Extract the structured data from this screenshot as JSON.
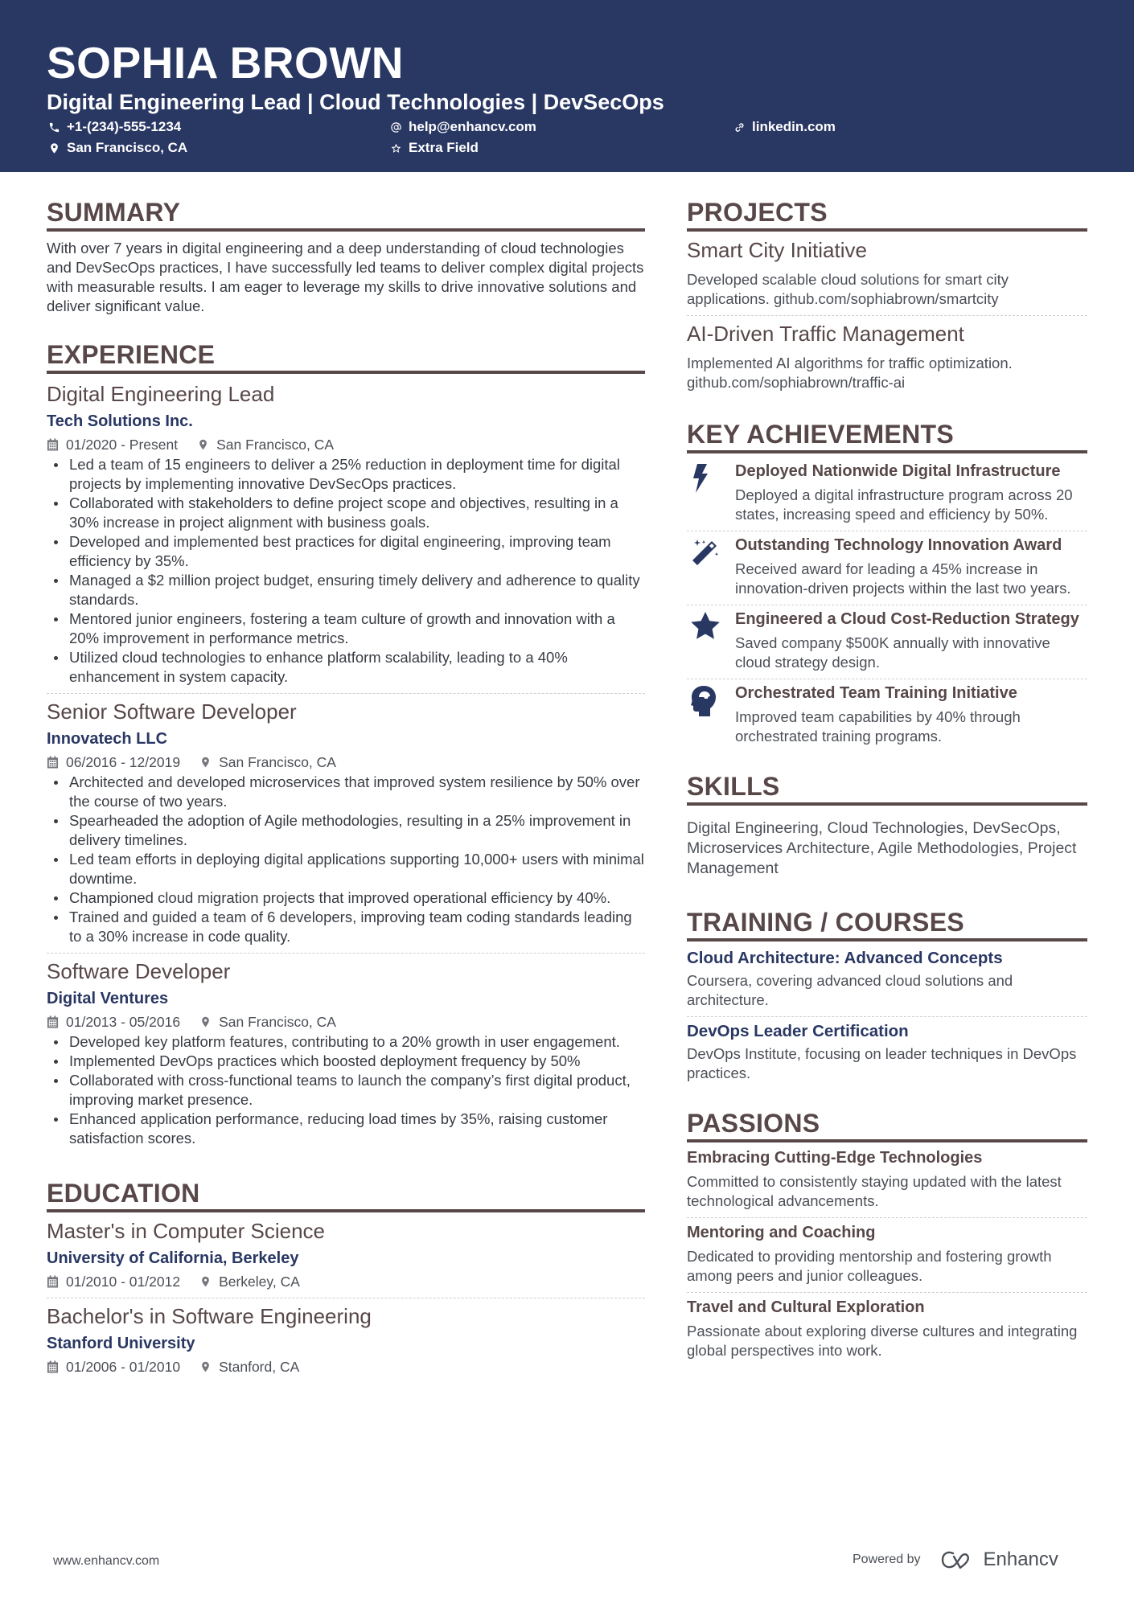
{
  "header": {
    "name": "SOPHIA BROWN",
    "headline": "Digital Engineering Lead | Cloud Technologies | DevSecOps",
    "contacts": [
      {
        "icon": "phone-icon",
        "text": "+1-(234)-555-1234"
      },
      {
        "icon": "at-icon",
        "text": "help@enhancv.com"
      },
      {
        "icon": "link-icon",
        "text": "linkedin.com"
      },
      {
        "icon": "map-pin-icon",
        "text": "San Francisco, CA"
      },
      {
        "icon": "star-outline-icon",
        "text": "Extra Field"
      }
    ]
  },
  "colors": {
    "header_bg": "#293763",
    "accent": "#293763",
    "heading": "#574748",
    "text": "#383c43"
  },
  "summary": {
    "title": "SUMMARY",
    "text": "With over 7 years in digital engineering and a deep understanding of cloud technologies and DevSecOps practices, I have successfully led teams to deliver complex digital projects with measurable results. I am eager to leverage my skills to drive innovative solutions and deliver significant value."
  },
  "experience": {
    "title": "EXPERIENCE",
    "items": [
      {
        "role": "Digital Engineering Lead",
        "company": "Tech Solutions Inc.",
        "dates": "01/2020 - Present",
        "location": "San Francisco, CA",
        "bullets": [
          "Led a team of 15 engineers to deliver a 25% reduction in deployment time for digital projects by implementing innovative DevSecOps practices.",
          "Collaborated with stakeholders to define project scope and objectives, resulting in a 30% increase in project alignment with business goals.",
          "Developed and implemented best practices for digital engineering, improving team efficiency by 35%.",
          "Managed a $2 million project budget, ensuring timely delivery and adherence to quality standards.",
          "Mentored junior engineers, fostering a team culture of growth and innovation with a 20% improvement in performance metrics.",
          "Utilized cloud technologies to enhance platform scalability, leading to a 40% enhancement in system capacity."
        ]
      },
      {
        "role": "Senior Software Developer",
        "company": "Innovatech LLC",
        "dates": "06/2016 - 12/2019",
        "location": "San Francisco, CA",
        "bullets": [
          "Architected and developed microservices that improved system resilience by 50% over the course of two years.",
          "Spearheaded the adoption of Agile methodologies, resulting in a 25% improvement in delivery timelines.",
          "Led team efforts in deploying digital applications supporting 10,000+ users with minimal downtime.",
          "Championed cloud migration projects that improved operational efficiency by 40%.",
          "Trained and guided a team of 6 developers, improving team coding standards leading to a 30% increase in code quality."
        ]
      },
      {
        "role": "Software Developer",
        "company": "Digital Ventures",
        "dates": "01/2013 - 05/2016",
        "location": "San Francisco, CA",
        "bullets": [
          "Developed key platform features, contributing to a 20% growth in user engagement.",
          "Implemented DevOps practices which boosted deployment frequency by 50%",
          "Collaborated with cross-functional teams to launch the company’s first digital product, improving market presence.",
          "Enhanced application performance, reducing load times by 35%, raising customer satisfaction scores."
        ]
      }
    ]
  },
  "education": {
    "title": "EDUCATION",
    "items": [
      {
        "degree": "Master's in Computer Science",
        "school": "University of California, Berkeley",
        "dates": "01/2010 - 01/2012",
        "location": "Berkeley, CA"
      },
      {
        "degree": "Bachelor's in Software Engineering",
        "school": "Stanford University",
        "dates": "01/2006 - 01/2010",
        "location": "Stanford, CA"
      }
    ]
  },
  "projects": {
    "title": "PROJECTS",
    "items": [
      {
        "title": "Smart City Initiative",
        "desc": "Developed scalable cloud solutions for smart city applications. github.com/sophiabrown/smartcity"
      },
      {
        "title": "AI-Driven Traffic Management",
        "desc": "Implemented AI algorithms for traffic optimization. github.com/sophiabrown/traffic-ai"
      }
    ]
  },
  "achievements": {
    "title": "KEY ACHIEVEMENTS",
    "items": [
      {
        "icon": "lightning-bolt-icon",
        "title": "Deployed Nationwide Digital Infrastructure",
        "desc": "Deployed a digital infrastructure program across 20 states, increasing speed and efficiency by 50%."
      },
      {
        "icon": "magic-wand-icon",
        "title": "Outstanding Technology Innovation Award",
        "desc": "Received award for leading a 45% increase in innovation-driven projects within the last two years."
      },
      {
        "icon": "star-icon",
        "title": "Engineered a Cloud Cost-Reduction Strategy",
        "desc": "Saved company $500K annually with innovative cloud strategy design."
      },
      {
        "icon": "brain-head-icon",
        "title": "Orchestrated Team Training Initiative",
        "desc": "Improved team capabilities by 40% through orchestrated training programs."
      }
    ]
  },
  "skills": {
    "title": "SKILLS",
    "text": "Digital Engineering, Cloud Technologies, DevSecOps, Microservices Architecture, Agile Methodologies, Project Management"
  },
  "training": {
    "title": "TRAINING / COURSES",
    "items": [
      {
        "title": "Cloud Architecture: Advanced Concepts",
        "desc": "Coursera, covering advanced cloud solutions and architecture."
      },
      {
        "title": "DevOps Leader Certification",
        "desc": "DevOps Institute, focusing on leader techniques in DevOps practices."
      }
    ]
  },
  "passions": {
    "title": "PASSIONS",
    "items": [
      {
        "title": "Embracing Cutting-Edge Technologies",
        "desc": "Committed to consistently staying updated with the latest technological advancements."
      },
      {
        "title": "Mentoring and Coaching",
        "desc": "Dedicated to providing mentorship and fostering growth among peers and junior colleagues."
      },
      {
        "title": "Travel and Cultural Exploration",
        "desc": "Passionate about exploring diverse cultures and integrating global perspectives into work."
      }
    ]
  },
  "footer": {
    "website": "www.enhancv.com",
    "powered_by": "Powered by",
    "brand": "Enhancv"
  }
}
